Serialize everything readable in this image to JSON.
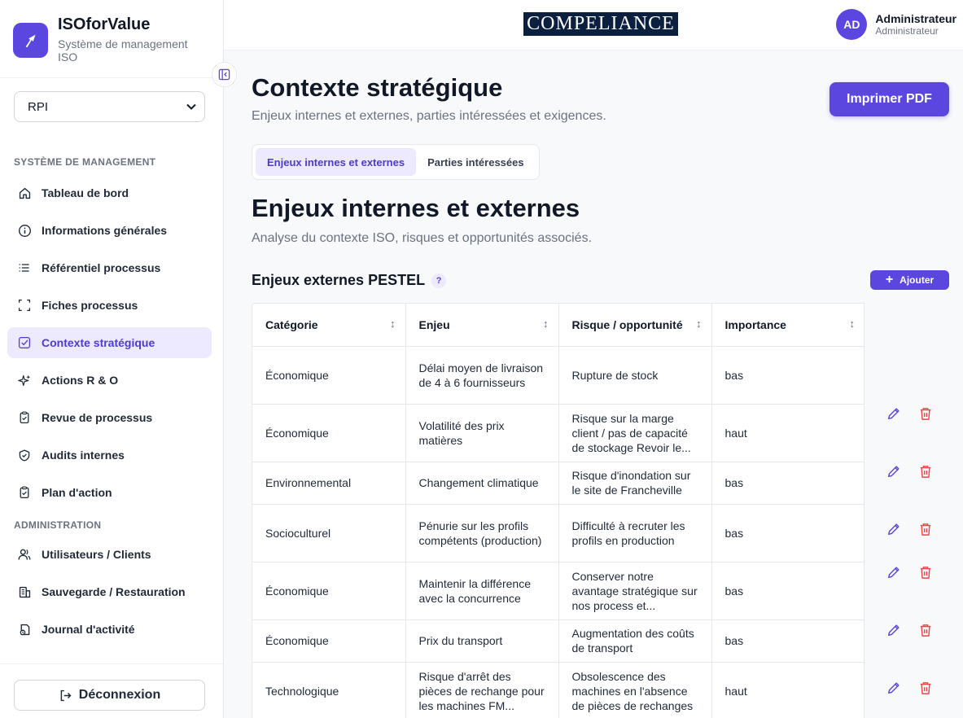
{
  "brand": {
    "title": "ISOforValue",
    "subtitle_line1": "Système de management",
    "subtitle_line2": "ISO"
  },
  "company_select": {
    "value": "RPI"
  },
  "sidebar": {
    "section1": "SYSTÈME DE MANAGEMENT",
    "items": [
      {
        "label": "Tableau de bord",
        "icon": "home-icon"
      },
      {
        "label": "Informations générales",
        "icon": "info-icon"
      },
      {
        "label": "Référentiel processus",
        "icon": "list-icon"
      },
      {
        "label": "Fiches processus",
        "icon": "frame-icon"
      },
      {
        "label": "Contexte stratégique",
        "icon": "checkbox-icon",
        "active": true
      },
      {
        "label": "Actions R & O",
        "icon": "sparkles-icon"
      },
      {
        "label": "Revue de processus",
        "icon": "clipboard-check-icon"
      },
      {
        "label": "Audits internes",
        "icon": "shield-check-icon"
      },
      {
        "label": "Plan d'action",
        "icon": "clipboard-check-icon"
      }
    ],
    "section2": "ADMINISTRATION",
    "admin_items": [
      {
        "label": "Utilisateurs / Clients",
        "icon": "users-icon"
      },
      {
        "label": "Sauvegarde / Restauration",
        "icon": "database-icon"
      },
      {
        "label": "Journal d'activité",
        "icon": "activity-icon"
      }
    ],
    "logout": "Déconnexion"
  },
  "header": {
    "logo_text": "COMPELIANCE",
    "user_initials": "AD",
    "user_name": "Administrateur",
    "user_role": "Administrateur"
  },
  "page": {
    "title": "Contexte stratégique",
    "subtitle": "Enjeux internes et externes, parties intéressées et exigences.",
    "pdf_button": "Imprimer PDF",
    "tabs": [
      "Enjeux internes et externes",
      "Parties intéressées"
    ],
    "section_title": "Enjeux internes et externes",
    "section_subtitle": "Analyse du contexte ISO, risques et opportunités associés.",
    "table_title": "Enjeux externes PESTEL",
    "help_label": "?",
    "add_button": "Ajouter"
  },
  "table": {
    "columns": [
      "Catégorie",
      "Enjeu",
      "Risque / opportunité",
      "Importance"
    ],
    "rows": [
      [
        "Économique",
        "Délai moyen de livraison de 4 à 6 fournisseurs",
        "Rupture de stock",
        "bas"
      ],
      [
        "Économique",
        "Volatilité des prix matières",
        "Risque sur la marge client / pas de capacité de stockage Revoir le...",
        "haut"
      ],
      [
        "Environnemental",
        "Changement climatique",
        "Risque d'inondation sur le site de Francheville",
        "bas"
      ],
      [
        "Socioculturel",
        "Pénurie sur les profils compétents (production)",
        "Difficulté à recruter les profils en production",
        "bas"
      ],
      [
        "Économique",
        "Maintenir la différence avec la concurrence",
        "Conserver notre avantage stratégique sur nos process et...",
        "bas"
      ],
      [
        "Économique",
        "Prix du transport",
        "Augmentation des coûts de transport",
        "bas"
      ],
      [
        "Technologique",
        "Risque d'arrêt des pièces de rechange pour les machines FM...",
        "Obsolescence des machines en l'absence de pièces de rechanges",
        "haut"
      ]
    ]
  },
  "colors": {
    "accent": "#5b46e0",
    "active_bg": "#ede9fe",
    "danger": "#ef4444",
    "logo_bg": "#0b1f3f"
  }
}
